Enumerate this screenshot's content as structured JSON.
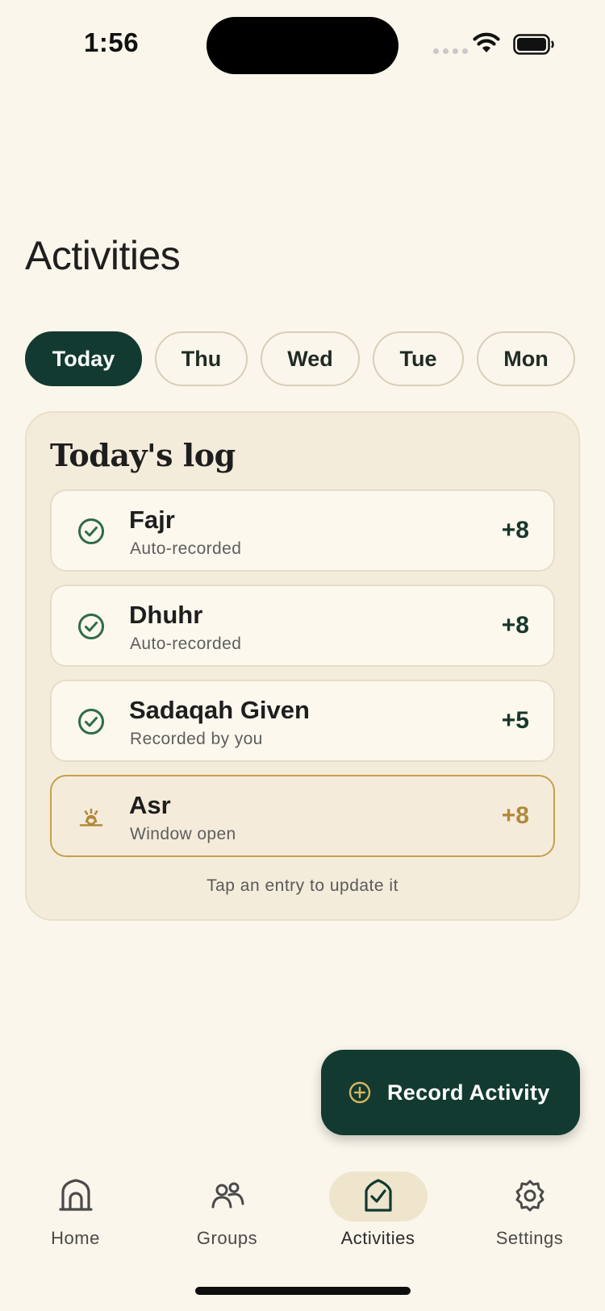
{
  "status_bar": {
    "time": "1:56"
  },
  "page": {
    "title": "Activities"
  },
  "day_filters": [
    {
      "label": "Today",
      "active": true
    },
    {
      "label": "Thu",
      "active": false
    },
    {
      "label": "Wed",
      "active": false
    },
    {
      "label": "Tue",
      "active": false
    },
    {
      "label": "Mon",
      "active": false
    }
  ],
  "log": {
    "title": "Today's log",
    "entries": [
      {
        "name": "Fajr",
        "subtitle": "Auto-recorded",
        "points": "+8",
        "icon": "check-circle-icon",
        "state": "done"
      },
      {
        "name": "Dhuhr",
        "subtitle": "Auto-recorded",
        "points": "+8",
        "icon": "check-circle-icon",
        "state": "done"
      },
      {
        "name": "Sadaqah Given",
        "subtitle": "Recorded by you",
        "points": "+5",
        "icon": "check-circle-icon",
        "state": "done"
      },
      {
        "name": "Asr",
        "subtitle": "Window open",
        "points": "+8",
        "icon": "sun-horizon-icon",
        "state": "pending"
      }
    ],
    "hint": "Tap an entry to update it"
  },
  "fab": {
    "label": "Record Activity",
    "icon": "plus-circle-icon"
  },
  "tabs": [
    {
      "label": "Home",
      "icon": "mosque-door-icon",
      "active": false
    },
    {
      "label": "Groups",
      "icon": "people-icon",
      "active": false
    },
    {
      "label": "Activities",
      "icon": "check-shield-icon",
      "active": true
    },
    {
      "label": "Settings",
      "icon": "gear-icon",
      "active": false
    }
  ],
  "colors": {
    "background": "#FAF6EB",
    "primary": "#123A30",
    "accent_gold": "#B08A3A",
    "success_green": "#2F6B4B"
  }
}
